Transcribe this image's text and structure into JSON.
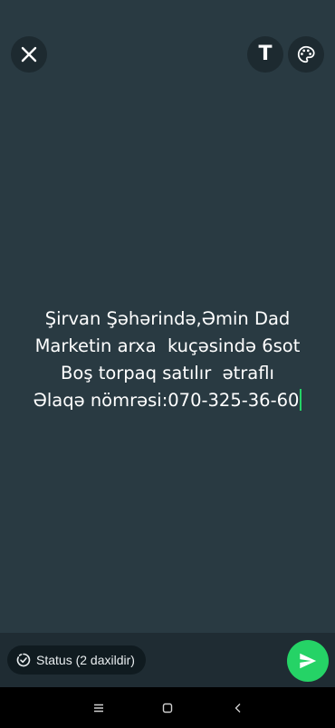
{
  "toolbar": {
    "close_icon": "close-icon",
    "text_tool_label": "T",
    "palette_icon": "palette-icon"
  },
  "status": {
    "lines": [
      "Şirvan Şəhərində,Əmin Dad",
      "Marketin arxa  kuçəsində 6sot",
      "Boş torpaq satılır  ətraflı",
      "Əlaqə nömrəsi:070-325-36-60"
    ]
  },
  "footer": {
    "audience_label": "Status (2 daxildir)",
    "send_icon": "send-icon"
  },
  "nav": {
    "recents_icon": "recents-icon",
    "home_icon": "home-icon",
    "back_icon": "back-icon"
  },
  "colors": {
    "background": "#293a42",
    "accent": "#25d366",
    "bar": "#1f2c33"
  }
}
